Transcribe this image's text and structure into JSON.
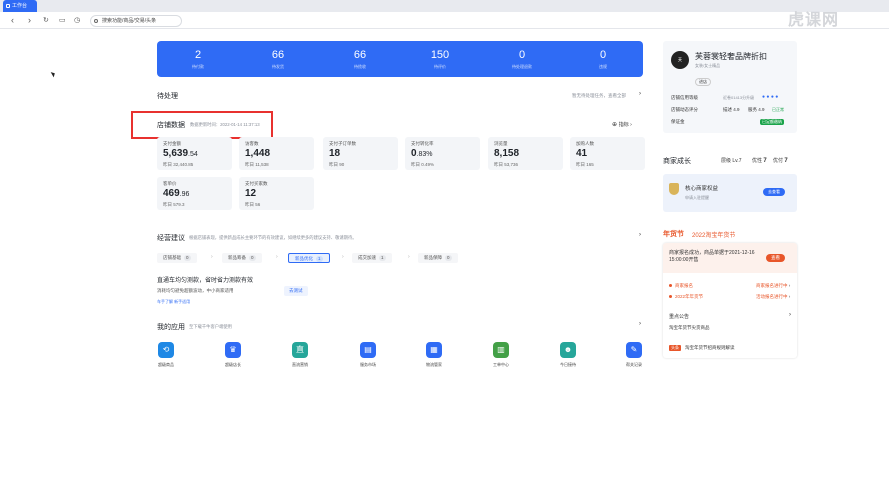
{
  "browser": {
    "tab_title": "工作台",
    "address": "搜索功能/商品/交易/头条"
  },
  "watermark": "虎课网",
  "stats": [
    {
      "value": "2",
      "label": "待付款"
    },
    {
      "value": "66",
      "label": "待发货"
    },
    {
      "value": "66",
      "label": "待揽收"
    },
    {
      "value": "150",
      "label": "待评价"
    },
    {
      "value": "0",
      "label": "待处理退款"
    },
    {
      "value": "0",
      "label": "违规"
    }
  ],
  "pending": {
    "title": "待处理",
    "link": "暂无待处理任务，查看全部"
  },
  "store_data": {
    "title": "店铺数据",
    "updated": "数据更新时间：2022-01-14 11:37:13",
    "indicator": "指标",
    "cards": [
      {
        "title": "支付金额",
        "value": "5,639",
        "decimal": ".54",
        "yesterday": "昨日 32,440.85"
      },
      {
        "title": "访客数",
        "value": "1,448",
        "decimal": "",
        "yesterday": "昨日 11,538"
      },
      {
        "title": "支付子订单数",
        "value": "18",
        "decimal": "",
        "yesterday": "昨日 90"
      },
      {
        "title": "支付转化率",
        "value": "0",
        "decimal": ".83%",
        "yesterday": "昨日 0.49%"
      },
      {
        "title": "浏览量",
        "value": "8,158",
        "decimal": "",
        "yesterday": "昨日 53,736"
      },
      {
        "title": "加购人数",
        "value": "41",
        "decimal": "",
        "yesterday": "昨日 165"
      },
      {
        "title": "客单价",
        "value": "469",
        "decimal": ".96",
        "yesterday": "昨日 579.3"
      },
      {
        "title": "支付买家数",
        "value": "12",
        "decimal": "",
        "yesterday": "昨日 56"
      }
    ]
  },
  "advice": {
    "title": "经营建议",
    "note": "根据店铺表现，提供新品成长主要环节的有效建议，如继续更多的建议支持、敬请期待。",
    "steps": [
      {
        "label": "店铺基础",
        "count": "0"
      },
      {
        "label": "新品筹备",
        "count": "0"
      },
      {
        "label": "新品优化",
        "count": "1"
      },
      {
        "label": "成交加速",
        "count": "1"
      },
      {
        "label": "新品保障",
        "count": "0"
      }
    ],
    "item_title": "直通车均匀测款，省时省力测款有效",
    "item_desc": "消耗均匀避免超额波动，中小商家适用",
    "item_btn": "去测试",
    "tags": "车手了解  新手适用"
  },
  "apps": {
    "title": "我的应用",
    "note": "至下载千牛客户端使用",
    "items": [
      {
        "label": "超级商品",
        "color": "#1e88e5",
        "glyph": "⟲"
      },
      {
        "label": "超级店长",
        "color": "#2f6bf5",
        "glyph": "♛"
      },
      {
        "label": "直流营销",
        "color": "#26a69a",
        "glyph": "直"
      },
      {
        "label": "服务市场",
        "color": "#2f6bf5",
        "glyph": "▤"
      },
      {
        "label": "物流管家",
        "color": "#2f6bf5",
        "glyph": "▦"
      },
      {
        "label": "工单中心",
        "color": "#43a047",
        "glyph": "▥"
      },
      {
        "label": "今日接待",
        "color": "#26a69a",
        "glyph": "☻"
      },
      {
        "label": "帮关记录",
        "color": "#2f6bf5",
        "glyph": "✎"
      }
    ]
  },
  "shop": {
    "name": "芙蓉裳轻奢品牌折扣",
    "category": "女装/女士精品",
    "badge": "进店",
    "level_label": "店铺信用等级",
    "level_note": "近卷01413分升级",
    "dsr_label": "店铺动态评分",
    "dsr_1": "描述 4.9",
    "dsr_2": "服务 4.9",
    "dsr_status": "已正常",
    "deposit_label": "保证金",
    "deposit_status": "已足额缴纳"
  },
  "growth": {
    "title": "商家成长",
    "level": "层级 Lv.7",
    "rank_label": "优性",
    "rank": "7",
    "comp_label": "优付",
    "comp": "7",
    "benefit": "核心商家权益",
    "benefit_sub": "申请入驻提醒",
    "btn": "去查看"
  },
  "festival": {
    "brand": "年货节",
    "title": "2022淘宝年货节",
    "notice": "商家报名成功，商品单据于2021-12-16 15:00:00开售",
    "btn": "查看",
    "items": [
      {
        "left": "商家报名",
        "right": "商家报名进行中"
      },
      {
        "left": "2022年年货节",
        "right": "活动报名进行中"
      }
    ],
    "announce": "重点公告",
    "announce_item": "淘宝年货节尖货商品",
    "news": "淘宝年货节招商规则解读",
    "news_tag": "头条"
  }
}
